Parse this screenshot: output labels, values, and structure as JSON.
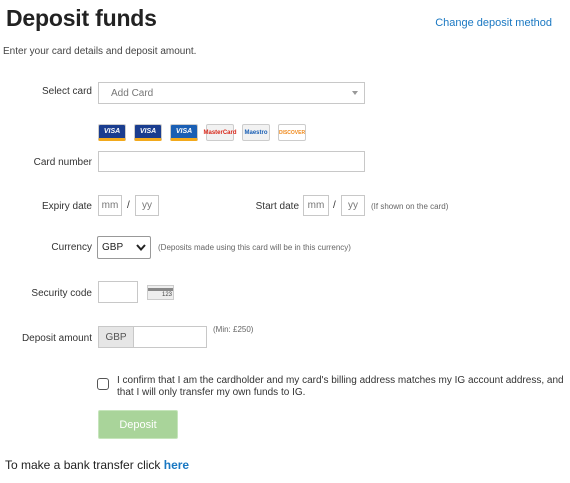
{
  "page": {
    "title": "Deposit funds",
    "change_method_link": "Change deposit method",
    "intro": "Enter your card details and deposit amount."
  },
  "form": {
    "select_card_label": "Select card",
    "select_card_placeholder": "Add Card",
    "card_logos": [
      {
        "name": "visa",
        "text": "VISA",
        "bg": "#1a3d8f",
        "fg": "#ffffff"
      },
      {
        "name": "visa",
        "text": "VISA",
        "bg": "#1a3d8f",
        "fg": "#ffffff"
      },
      {
        "name": "visa-electron",
        "text": "VISA",
        "bg": "#1a5fb4",
        "fg": "#ffffff"
      },
      {
        "name": "mastercard",
        "text": "MasterCard",
        "bg": "#f2f2f2",
        "fg": "#d9281a"
      },
      {
        "name": "maestro",
        "text": "Maestro",
        "bg": "#f2f2f2",
        "fg": "#1a5fb4"
      },
      {
        "name": "discover",
        "text": "DISCOVER",
        "bg": "#ffffff",
        "fg": "#f08a1c"
      }
    ],
    "card_number_label": "Card number",
    "card_number_value": "",
    "expiry_label": "Expiry date",
    "expiry_mm_placeholder": "mm",
    "expiry_yy_placeholder": "yy",
    "slash": "/",
    "start_label": "Start date",
    "start_mm_placeholder": "mm",
    "start_yy_placeholder": "yy",
    "start_note": "(If shown on the card)",
    "currency_label": "Currency",
    "currency_value": "GBP",
    "currency_note": "(Deposits made using this card will be in this currency)",
    "security_label": "Security code",
    "security_value": "",
    "security_card_hint": "123",
    "deposit_label": "Deposit amount",
    "deposit_prefix": "GBP",
    "deposit_value": "",
    "deposit_min_note": "(Min: £250)",
    "confirm_text": "I confirm that I am the cardholder and my card's billing address matches my IG account address, and that I will only transfer my own funds to IG.",
    "confirm_checked": false,
    "deposit_button": "Deposit"
  },
  "footer": {
    "bank_text": "To make a bank transfer click ",
    "bank_link": "here"
  },
  "colors": {
    "link": "#1a78c2",
    "deposit_button_bg": "#a9d49a"
  }
}
